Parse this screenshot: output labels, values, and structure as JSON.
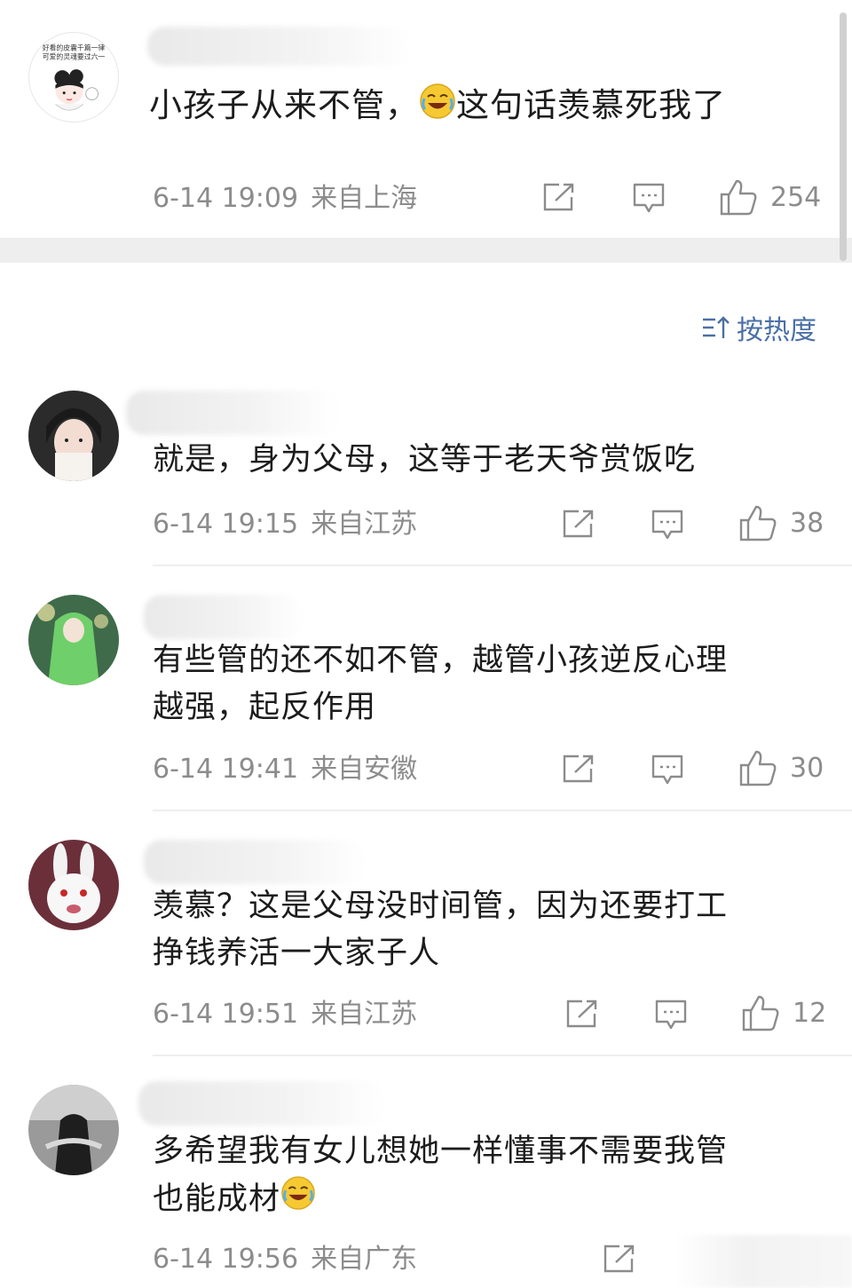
{
  "top_comment": {
    "text": "小孩子从来不管，😂这句话羡慕死我了",
    "text_before_emoji": "小孩子从来不管，",
    "text_after_emoji": "这句话羡慕死我了",
    "date": "6-14 19:09",
    "location": "来自上海",
    "likes": "254",
    "avatar_caption_line1": "好看的皮囊千篇一律",
    "avatar_caption_line2": "可爱的灵魂要过六一"
  },
  "sort": {
    "label": "按热度",
    "icon": "sort-icon"
  },
  "comments": [
    {
      "text_line1": "就是，身为父母，这等于老天爷赏饭吃",
      "text_line2": "",
      "date": "6-14 19:15",
      "location": "来自江苏",
      "likes": "38"
    },
    {
      "text_line1": "有些管的还不如不管，越管小孩逆反心理",
      "text_line2": "越强，起反作用",
      "date": "6-14 19:41",
      "location": "来自安徽",
      "likes": "30"
    },
    {
      "text_line1": "羡慕？这是父母没时间管，因为还要打工",
      "text_line2": "挣钱养活一大家子人",
      "date": "6-14 19:51",
      "location": "来自江苏",
      "likes": "12"
    },
    {
      "text_line1": "多希望我有女儿想她一样懂事不需要我管",
      "text_line2": "也能成材",
      "date": "6-14 19:56",
      "location": "来自广东",
      "likes": ""
    }
  ],
  "colors": {
    "meta": "#8c8c8c",
    "accent": "#4a6fa5",
    "divider": "#eeeeee"
  },
  "icons": {
    "share": "share-icon",
    "comment": "comment-icon",
    "like": "like-icon"
  }
}
